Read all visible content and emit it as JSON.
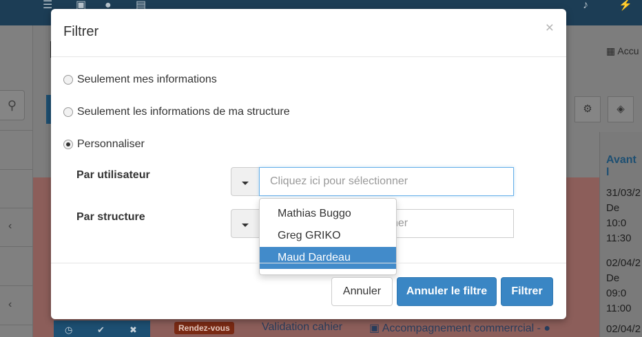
{
  "background": {
    "accueil_label": "Accu",
    "column_header": "Avant l",
    "rows": [
      {
        "lines": [
          "31/03/2",
          "De 10:0",
          "11:30"
        ]
      },
      {
        "lines": [
          "02/04/2",
          "De 09:0",
          "11:00"
        ]
      },
      {
        "lines": [
          "02/04/2"
        ]
      }
    ],
    "badge": "Rendez-vous",
    "link_1": "Validation cahier",
    "link_2": "Accompagnement commerrcial -"
  },
  "modal": {
    "title": "Filtrer",
    "close_symbol": "×",
    "options": [
      {
        "label": "Seulement mes informations",
        "checked": false
      },
      {
        "label": "Seulement les informations de ma structure",
        "checked": false
      },
      {
        "label": "Personnaliser",
        "checked": true
      }
    ],
    "user_filter": {
      "label": "Par utilisateur",
      "placeholder": "Cliquez ici pour sélectionner"
    },
    "structure_filter": {
      "label": "Par structure",
      "placeholder": "Cliquez ici pour sélectionner"
    },
    "dropdown_items": [
      {
        "label": "Mathias Buggo",
        "selected": false
      },
      {
        "label": "Greg GRIKO",
        "selected": false
      },
      {
        "label": "Maud Dardeau",
        "selected": true
      }
    ],
    "buttons": {
      "cancel": "Annuler",
      "clear_filter": "Annuler le filtre",
      "apply": "Filtrer"
    }
  },
  "colors": {
    "primary": "#3a86c4",
    "selected_item": "#428bca",
    "topbar": "#1c3d55"
  }
}
